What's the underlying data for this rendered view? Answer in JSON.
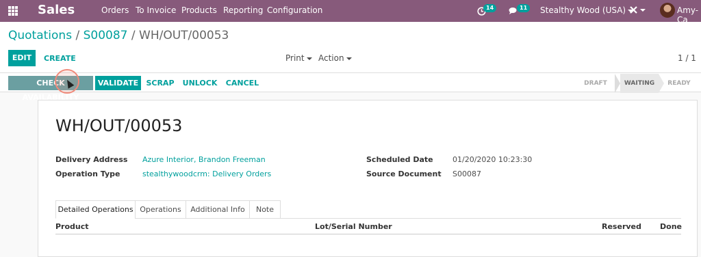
{
  "navbar": {
    "app_name": "Sales",
    "menu": [
      "Orders",
      "To Invoice",
      "Products",
      "Reporting",
      "Configuration"
    ],
    "activity_count": "14",
    "message_count": "11",
    "company": "Stealthy Wood (USA)",
    "user": "Amy-Ca"
  },
  "breadcrumb": {
    "items": [
      "Quotations",
      "S00087"
    ],
    "current": "WH/OUT/00053",
    "separator": "/"
  },
  "buttons": {
    "edit": "EDIT",
    "create": "CREATE",
    "print": "Print",
    "action": "Action"
  },
  "pager": "1 / 1",
  "actions": {
    "check_availability": "CHECK AVAILABILITY",
    "validate": "VALIDATE",
    "scrap": "SCRAP",
    "unlock": "UNLOCK",
    "cancel": "CANCEL"
  },
  "status": {
    "stages": [
      "DRAFT",
      "WAITING",
      "READY"
    ],
    "current": "WAITING"
  },
  "form": {
    "title": "WH/OUT/00053",
    "delivery_address_label": "Delivery Address",
    "delivery_address": "Azure Interior, Brandon Freeman",
    "operation_type_label": "Operation Type",
    "operation_type": "stealthywoodcrm: Delivery Orders",
    "scheduled_date_label": "Scheduled Date",
    "scheduled_date": "01/20/2020 10:23:30",
    "source_document_label": "Source Document",
    "source_document": "S00087"
  },
  "tabs": [
    "Detailed Operations",
    "Operations",
    "Additional Info",
    "Note"
  ],
  "table": {
    "columns": [
      "Product",
      "Lot/Serial Number",
      "Reserved",
      "Done"
    ]
  },
  "colors": {
    "navbar": "#875a7b",
    "primary": "#00a09d"
  }
}
